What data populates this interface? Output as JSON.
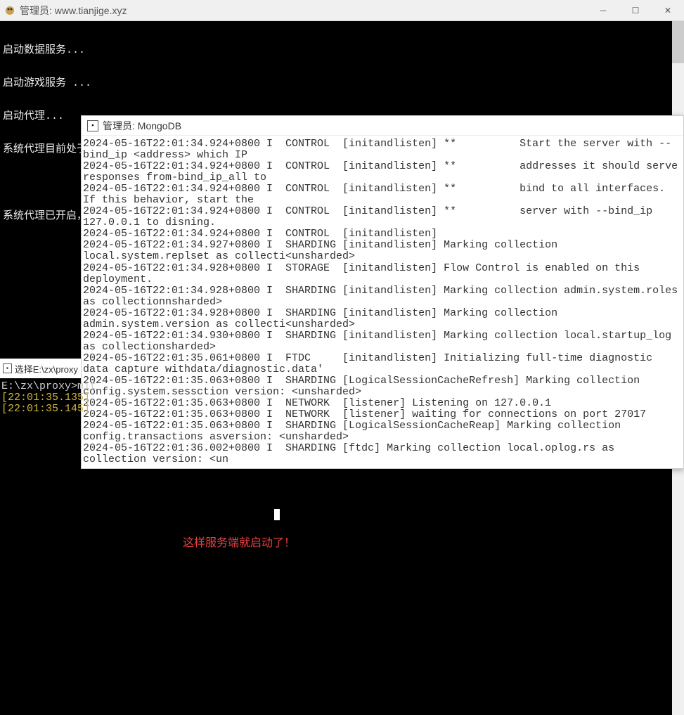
{
  "mainWindow": {
    "title": "管理员:  www.tianjige.xyz",
    "lines": [
      "启动数据服务...",
      "启动游戏服务 ...",
      "启动代理...",
      "系统代理目前处于关闭状态，正在开启代理，请稍候...",
      "",
      "系统代理已开启，请按任意键关闭本窗口，本游戏由www.tianjige.xyz整理，是免费的，如果你是付费的，请举报！"
    ]
  },
  "mongoWindow": {
    "title": "管理员:  MongoDB",
    "log": "2024-05-16T22:01:34.924+0800 I  CONTROL  [initandlisten] **          Start the server with --bind_ip <address> which IP\n2024-05-16T22:01:34.924+0800 I  CONTROL  [initandlisten] **          addresses it should serve responses from-bind_ip_all to\n2024-05-16T22:01:34.924+0800 I  CONTROL  [initandlisten] **          bind to all interfaces. If this behavior, start the\n2024-05-16T22:01:34.924+0800 I  CONTROL  [initandlisten] **          server with --bind_ip 127.0.0.1 to disning.\n2024-05-16T22:01:34.924+0800 I  CONTROL  [initandlisten]\n2024-05-16T22:01:34.927+0800 I  SHARDING [initandlisten] Marking collection local.system.replset as collecti<unsharded>\n2024-05-16T22:01:34.928+0800 I  STORAGE  [initandlisten] Flow Control is enabled on this deployment.\n2024-05-16T22:01:34.928+0800 I  SHARDING [initandlisten] Marking collection admin.system.roles as collectionnsharded>\n2024-05-16T22:01:34.928+0800 I  SHARDING [initandlisten] Marking collection admin.system.version as collecti<unsharded>\n2024-05-16T22:01:34.930+0800 I  SHARDING [initandlisten] Marking collection local.startup_log as collectionsharded>\n2024-05-16T22:01:35.061+0800 I  FTDC     [initandlisten] Initializing full-time diagnostic data capture withdata/diagnostic.data'\n2024-05-16T22:01:35.063+0800 I  SHARDING [LogicalSessionCacheRefresh] Marking collection config.system.sessction version: <unsharded>\n2024-05-16T22:01:35.063+0800 I  NETWORK  [listener] Listening on 127.0.0.1\n2024-05-16T22:01:35.063+0800 I  NETWORK  [listener] waiting for connections on port 27017\n2024-05-16T22:01:35.063+0800 I  SHARDING [LogicalSessionCacheReap] Marking collection config.transactions asversion: <unsharded>\n2024-05-16T22:01:36.002+0800 I  SHARDING [ftdc] Marking collection local.oplog.rs as collection version: <un"
  },
  "proxyWindow": {
    "title": "选择E:\\zx\\proxy",
    "path": "E:\\zx\\proxy>mit",
    "ts1": "[22:01:35.135]",
    "ts2": "[22:01:35.145]"
  },
  "annotation": "这样服务端就启动了！"
}
